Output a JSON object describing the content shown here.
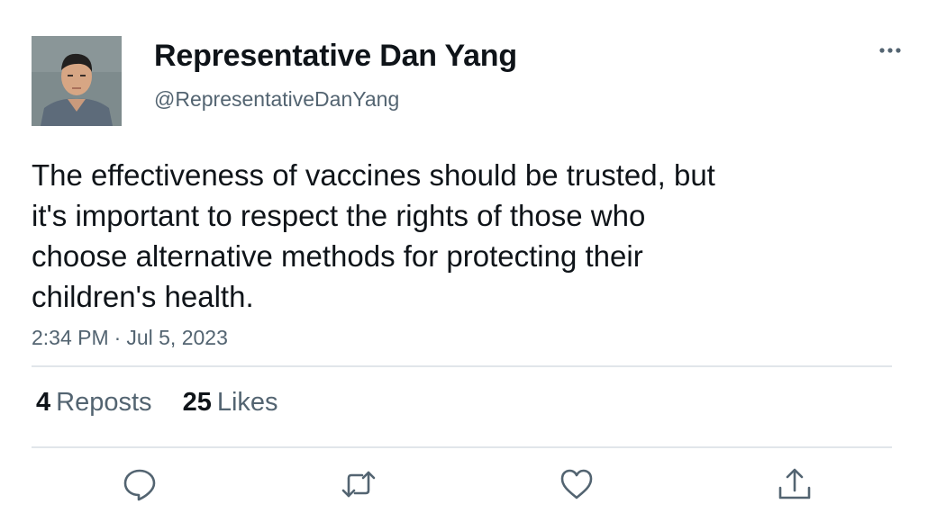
{
  "author": {
    "display_name": "Representative Dan Yang",
    "handle": "@RepresentativeDanYang"
  },
  "tweet": {
    "text": "The effectiveness of vaccines should be trusted, but\nit's important to respect the rights of those who\nchoose alternative methods for protecting their\nchildren's health.",
    "time": "2:34 PM",
    "separator": "·",
    "date": "Jul 5, 2023"
  },
  "stats": {
    "reposts_count": "4",
    "reposts_label": "Reposts",
    "likes_count": "25",
    "likes_label": "Likes"
  },
  "icons": {
    "more": "more-horizontal-icon",
    "reply": "reply-icon",
    "repost": "repost-icon",
    "like": "heart-icon",
    "share": "share-icon"
  },
  "colors": {
    "text": "#0f1419",
    "secondary": "#536471",
    "divider": "#e1e6ea"
  }
}
